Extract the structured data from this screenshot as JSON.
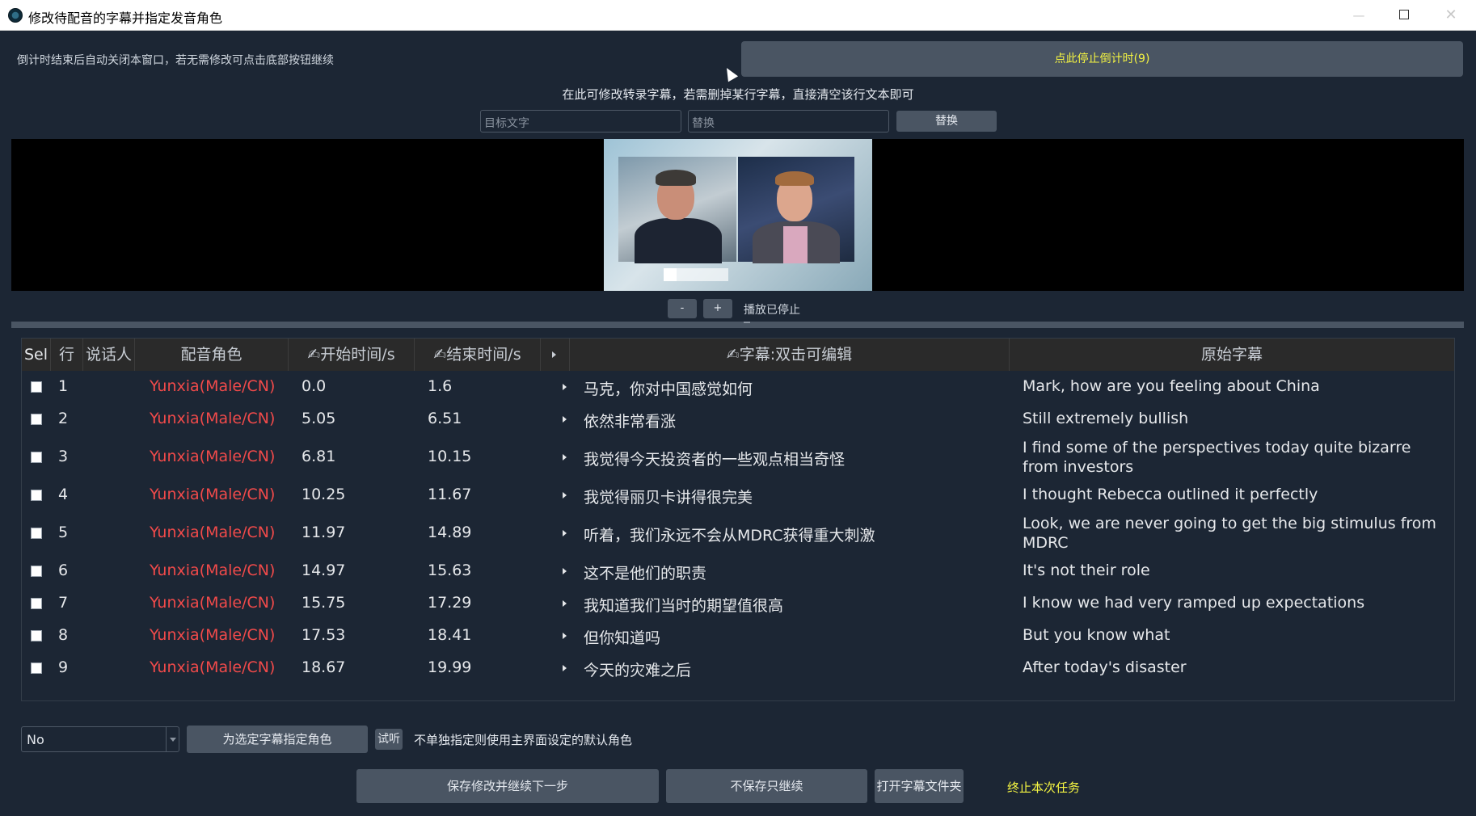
{
  "window": {
    "title": "修改待配音的字幕并指定发音角色",
    "minimize": "—",
    "close": "✕"
  },
  "countdown": {
    "hint": "倒计时结束后自动关闭本窗口，若无需修改可点击底部按钮继续",
    "stop_button": "点此停止倒计时(9)"
  },
  "edit_hint": "在此可修改转录字幕，若需删掉某行字幕，直接清空该行文本即可",
  "find_replace": {
    "target_placeholder": "目标文字",
    "replace_placeholder": "替换",
    "replace_button": "替换"
  },
  "playback": {
    "minus": "-",
    "plus": "+",
    "status": "播放已停止"
  },
  "table": {
    "headers": {
      "sel": "Sel",
      "line": "行",
      "speaker": "说话人",
      "role": "配音角色",
      "start": "✍开始时间/s",
      "end": "✍结束时间/s",
      "subtitle": "✍字幕:双击可编辑",
      "original": "原始字幕"
    },
    "rows": [
      {
        "line": "1",
        "role": "Yunxia(Male/CN)",
        "start": "0.0",
        "end": "1.6",
        "subtitle": "马克，你对中国感觉如何",
        "original": "Mark, how are you feeling about China"
      },
      {
        "line": "2",
        "role": "Yunxia(Male/CN)",
        "start": "5.05",
        "end": "6.51",
        "subtitle": "依然非常看涨",
        "original": "Still extremely bullish"
      },
      {
        "line": "3",
        "role": "Yunxia(Male/CN)",
        "start": "6.81",
        "end": "10.15",
        "subtitle": "我觉得今天投资者的一些观点相当奇怪",
        "original": "I find some of the perspectives today quite bizarre from investors"
      },
      {
        "line": "4",
        "role": "Yunxia(Male/CN)",
        "start": "10.25",
        "end": "11.67",
        "subtitle": "我觉得丽贝卡讲得很完美",
        "original": "I thought Rebecca outlined it perfectly"
      },
      {
        "line": "5",
        "role": "Yunxia(Male/CN)",
        "start": "11.97",
        "end": "14.89",
        "subtitle": "听着，我们永远不会从MDRC获得重大刺激",
        "original": "Look, we are never going to get the big stimulus from MDRC"
      },
      {
        "line": "6",
        "role": "Yunxia(Male/CN)",
        "start": "14.97",
        "end": "15.63",
        "subtitle": "这不是他们的职责",
        "original": "It's not their role"
      },
      {
        "line": "7",
        "role": "Yunxia(Male/CN)",
        "start": "15.75",
        "end": "17.29",
        "subtitle": "我知道我们当时的期望值很高",
        "original": "I know we had very ramped up expectations"
      },
      {
        "line": "8",
        "role": "Yunxia(Male/CN)",
        "start": "17.53",
        "end": "18.41",
        "subtitle": "但你知道吗",
        "original": "But you know what"
      },
      {
        "line": "9",
        "role": "Yunxia(Male/CN)",
        "start": "18.67",
        "end": "19.99",
        "subtitle": "今天的灾难之后",
        "original": "After today's disaster"
      }
    ]
  },
  "role_assign": {
    "select_value": "No",
    "assign_button": "为选定字幕指定角色",
    "listen_button": "试听",
    "hint": "不单独指定则使用主界面设定的默认角色"
  },
  "actions": {
    "save_continue": "保存修改并继续下一步",
    "continue_nosave": "不保存只继续",
    "open_folder": "打开字幕文件夹",
    "terminate": "终止本次任务"
  },
  "colors": {
    "background": "#1c2634",
    "button": "#4a5563",
    "accent_yellow": "#f5f542",
    "role_red": "#f14a4a"
  }
}
